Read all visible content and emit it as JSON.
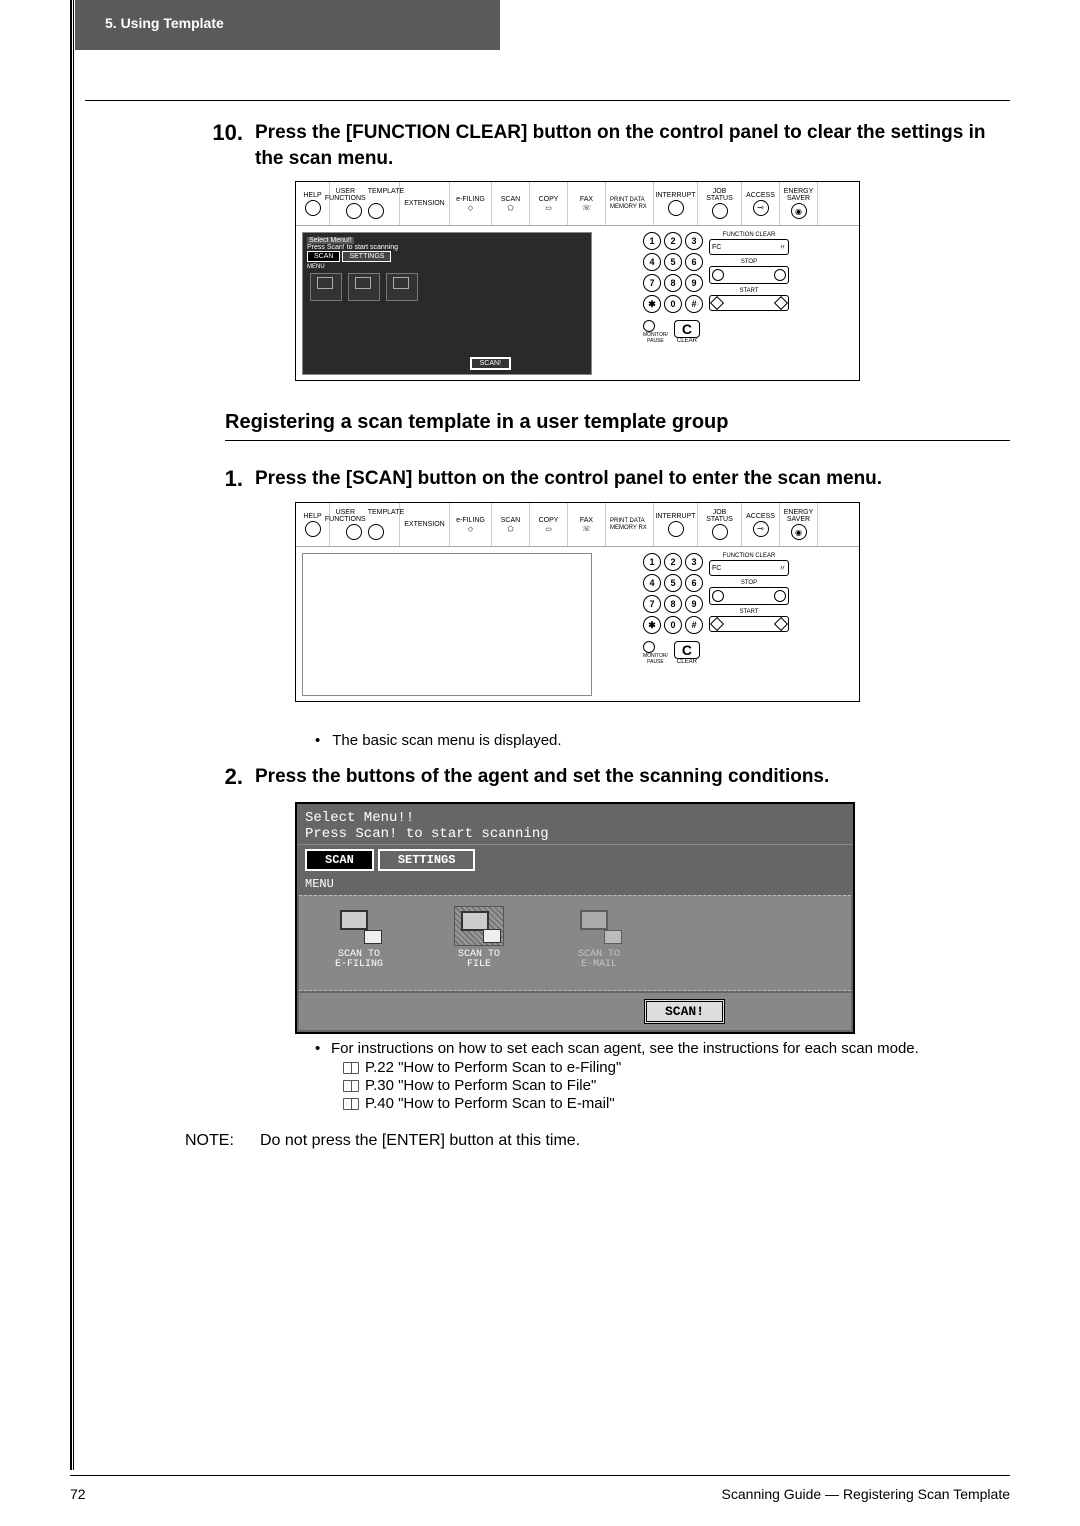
{
  "header": {
    "tab": "5. Using Template"
  },
  "steps": {
    "s10": {
      "num": "10.",
      "text": "Press the [FUNCTION CLEAR] button on the control panel to clear the settings in the scan menu."
    },
    "s1": {
      "num": "1.",
      "text": "Press the [SCAN] button on the control panel to enter the scan menu."
    },
    "s2": {
      "num": "2.",
      "text": "Press the buttons of the agent and set the scanning conditions."
    }
  },
  "section": {
    "heading": "Registering a scan template in a user template group"
  },
  "bullets": {
    "basic_scan": "The basic scan menu is displayed.",
    "instructions": "For instructions on how to set each scan agent, see the instructions for each scan mode.",
    "ref1": "P.22 \"How to Perform Scan to e-Filing\"",
    "ref2": "P.30 \"How to Perform Scan to File\"",
    "ref3": "P.40 \"How to Perform Scan to E-mail\""
  },
  "panel": {
    "top": {
      "help": "HELP",
      "user_functions": "USER FUNCTIONS",
      "template": "TEMPLATE",
      "extension": "EXTENSION",
      "efiling": "e-FILING",
      "scan": "SCAN",
      "copy": "COPY",
      "fax": "FAX",
      "print_data": "PRINT DATA",
      "memory_rx": "MEMORY RX",
      "interrupt": "INTERRUPT",
      "job_status": "JOB STATUS",
      "access": "ACCESS",
      "energy_saver": "ENERGY SAVER"
    },
    "screen": {
      "line1": "Select Menu!!",
      "line2": "Press Scan! to start scanning",
      "tab_scan": "SCAN",
      "tab_settings": "SETTINGS",
      "menu": "MENU",
      "scan_btn": "SCAN!"
    },
    "right": {
      "function_clear": "FUNCTION CLEAR",
      "fc": "FC",
      "stop": "STOP",
      "start": "START",
      "monitor_pause": "MONITOR/\nPAUSE",
      "clear": "CLEAR",
      "clear_c": "C"
    },
    "keypad": [
      "1",
      "2",
      "3",
      "4",
      "5",
      "6",
      "7",
      "8",
      "9",
      "✱",
      "0",
      "#"
    ]
  },
  "big_screen": {
    "line1": "Select Menu!!",
    "line2": "Press Scan! to start scanning",
    "tab_scan": "SCAN",
    "tab_settings": "SETTINGS",
    "menu": "MENU",
    "icon1": "SCAN TO\nE-FILING",
    "icon2": "SCAN TO\nFILE",
    "icon3": "SCAN TO\nE-MAIL",
    "scan_btn": "SCAN!"
  },
  "note": {
    "label": "NOTE:",
    "text": "Do not press the [ENTER] button at this time."
  },
  "footer": {
    "page": "72",
    "text": "Scanning Guide — Registering Scan Template"
  }
}
